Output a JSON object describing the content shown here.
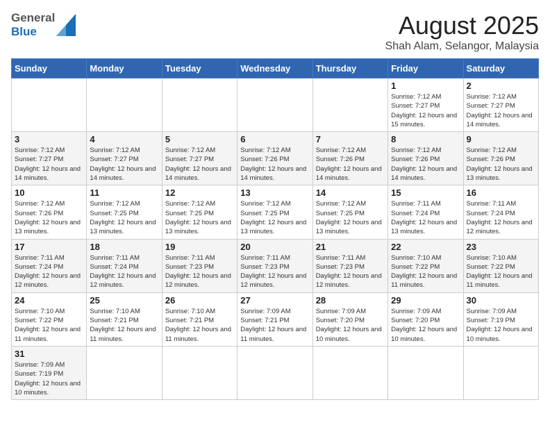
{
  "header": {
    "title": "August 2025",
    "subtitle": "Shah Alam, Selangor, Malaysia",
    "logo_general": "General",
    "logo_blue": "Blue"
  },
  "weekdays": [
    "Sunday",
    "Monday",
    "Tuesday",
    "Wednesday",
    "Thursday",
    "Friday",
    "Saturday"
  ],
  "weeks": [
    [
      {
        "day": "",
        "info": ""
      },
      {
        "day": "",
        "info": ""
      },
      {
        "day": "",
        "info": ""
      },
      {
        "day": "",
        "info": ""
      },
      {
        "day": "",
        "info": ""
      },
      {
        "day": "1",
        "info": "Sunrise: 7:12 AM\nSunset: 7:27 PM\nDaylight: 12 hours\nand 15 minutes."
      },
      {
        "day": "2",
        "info": "Sunrise: 7:12 AM\nSunset: 7:27 PM\nDaylight: 12 hours\nand 14 minutes."
      }
    ],
    [
      {
        "day": "3",
        "info": "Sunrise: 7:12 AM\nSunset: 7:27 PM\nDaylight: 12 hours\nand 14 minutes."
      },
      {
        "day": "4",
        "info": "Sunrise: 7:12 AM\nSunset: 7:27 PM\nDaylight: 12 hours\nand 14 minutes."
      },
      {
        "day": "5",
        "info": "Sunrise: 7:12 AM\nSunset: 7:27 PM\nDaylight: 12 hours\nand 14 minutes."
      },
      {
        "day": "6",
        "info": "Sunrise: 7:12 AM\nSunset: 7:26 PM\nDaylight: 12 hours\nand 14 minutes."
      },
      {
        "day": "7",
        "info": "Sunrise: 7:12 AM\nSunset: 7:26 PM\nDaylight: 12 hours\nand 14 minutes."
      },
      {
        "day": "8",
        "info": "Sunrise: 7:12 AM\nSunset: 7:26 PM\nDaylight: 12 hours\nand 14 minutes."
      },
      {
        "day": "9",
        "info": "Sunrise: 7:12 AM\nSunset: 7:26 PM\nDaylight: 12 hours\nand 13 minutes."
      }
    ],
    [
      {
        "day": "10",
        "info": "Sunrise: 7:12 AM\nSunset: 7:26 PM\nDaylight: 12 hours\nand 13 minutes."
      },
      {
        "day": "11",
        "info": "Sunrise: 7:12 AM\nSunset: 7:25 PM\nDaylight: 12 hours\nand 13 minutes."
      },
      {
        "day": "12",
        "info": "Sunrise: 7:12 AM\nSunset: 7:25 PM\nDaylight: 12 hours\nand 13 minutes."
      },
      {
        "day": "13",
        "info": "Sunrise: 7:12 AM\nSunset: 7:25 PM\nDaylight: 12 hours\nand 13 minutes."
      },
      {
        "day": "14",
        "info": "Sunrise: 7:12 AM\nSunset: 7:25 PM\nDaylight: 12 hours\nand 13 minutes."
      },
      {
        "day": "15",
        "info": "Sunrise: 7:11 AM\nSunset: 7:24 PM\nDaylight: 12 hours\nand 13 minutes."
      },
      {
        "day": "16",
        "info": "Sunrise: 7:11 AM\nSunset: 7:24 PM\nDaylight: 12 hours\nand 12 minutes."
      }
    ],
    [
      {
        "day": "17",
        "info": "Sunrise: 7:11 AM\nSunset: 7:24 PM\nDaylight: 12 hours\nand 12 minutes."
      },
      {
        "day": "18",
        "info": "Sunrise: 7:11 AM\nSunset: 7:24 PM\nDaylight: 12 hours\nand 12 minutes."
      },
      {
        "day": "19",
        "info": "Sunrise: 7:11 AM\nSunset: 7:23 PM\nDaylight: 12 hours\nand 12 minutes."
      },
      {
        "day": "20",
        "info": "Sunrise: 7:11 AM\nSunset: 7:23 PM\nDaylight: 12 hours\nand 12 minutes."
      },
      {
        "day": "21",
        "info": "Sunrise: 7:11 AM\nSunset: 7:23 PM\nDaylight: 12 hours\nand 12 minutes."
      },
      {
        "day": "22",
        "info": "Sunrise: 7:10 AM\nSunset: 7:22 PM\nDaylight: 12 hours\nand 11 minutes."
      },
      {
        "day": "23",
        "info": "Sunrise: 7:10 AM\nSunset: 7:22 PM\nDaylight: 12 hours\nand 11 minutes."
      }
    ],
    [
      {
        "day": "24",
        "info": "Sunrise: 7:10 AM\nSunset: 7:22 PM\nDaylight: 12 hours\nand 11 minutes."
      },
      {
        "day": "25",
        "info": "Sunrise: 7:10 AM\nSunset: 7:21 PM\nDaylight: 12 hours\nand 11 minutes."
      },
      {
        "day": "26",
        "info": "Sunrise: 7:10 AM\nSunset: 7:21 PM\nDaylight: 12 hours\nand 11 minutes."
      },
      {
        "day": "27",
        "info": "Sunrise: 7:09 AM\nSunset: 7:21 PM\nDaylight: 12 hours\nand 11 minutes."
      },
      {
        "day": "28",
        "info": "Sunrise: 7:09 AM\nSunset: 7:20 PM\nDaylight: 12 hours\nand 10 minutes."
      },
      {
        "day": "29",
        "info": "Sunrise: 7:09 AM\nSunset: 7:20 PM\nDaylight: 12 hours\nand 10 minutes."
      },
      {
        "day": "30",
        "info": "Sunrise: 7:09 AM\nSunset: 7:19 PM\nDaylight: 12 hours\nand 10 minutes."
      }
    ],
    [
      {
        "day": "31",
        "info": "Sunrise: 7:09 AM\nSunset: 7:19 PM\nDaylight: 12 hours\nand 10 minutes."
      },
      {
        "day": "",
        "info": ""
      },
      {
        "day": "",
        "info": ""
      },
      {
        "day": "",
        "info": ""
      },
      {
        "day": "",
        "info": ""
      },
      {
        "day": "",
        "info": ""
      },
      {
        "day": "",
        "info": ""
      }
    ]
  ]
}
